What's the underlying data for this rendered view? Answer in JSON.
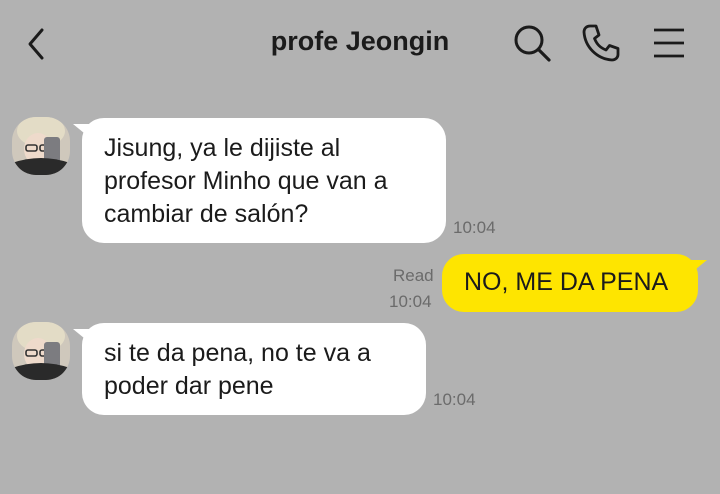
{
  "header": {
    "title": "profe Jeongin",
    "icons": [
      "back-icon",
      "search-icon",
      "phone-icon",
      "menu-icon"
    ]
  },
  "colors": {
    "background": "#b2b2b2",
    "incoming_bubble": "#ffffff",
    "outgoing_bubble": "#fee500"
  },
  "messages": [
    {
      "direction": "incoming",
      "lines": [
        "Jisung, ya le dijiste al",
        "profesor Minho que van a",
        "cambiar de salón?"
      ],
      "time": "10:04"
    },
    {
      "direction": "outgoing",
      "text": "NO, ME DA PENA",
      "read_label": "Read",
      "time": "10:04"
    },
    {
      "direction": "incoming",
      "lines": [
        "si te da pena, no te va a",
        "poder dar pene"
      ],
      "time": "10:04"
    }
  ]
}
